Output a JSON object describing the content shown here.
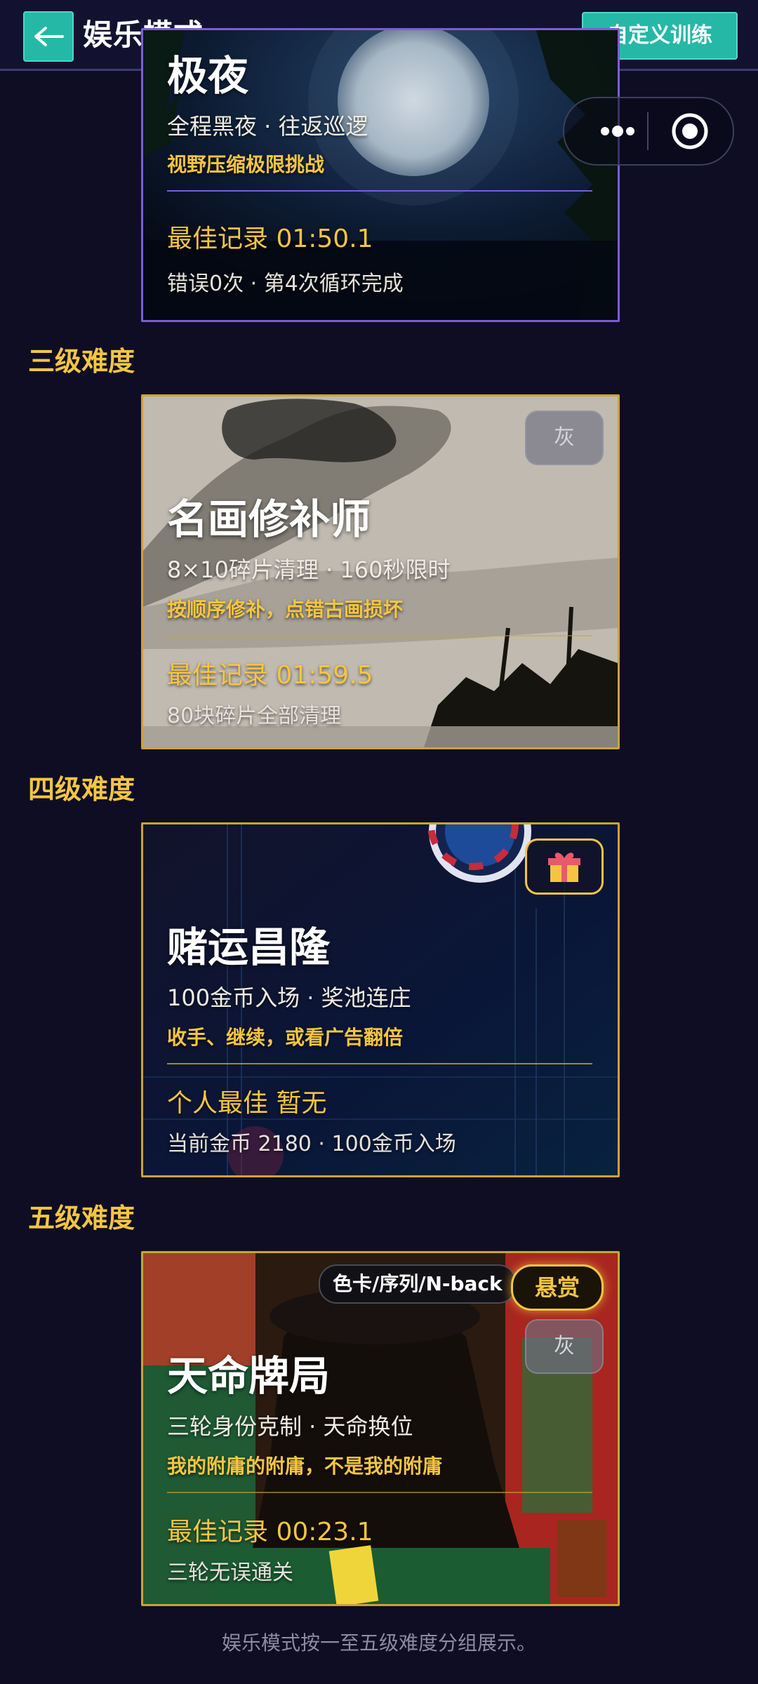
{
  "header": {
    "title": "娱乐模式",
    "custom_button": "自定义训练"
  },
  "levels": [
    {
      "title": "三级难度"
    },
    {
      "title": "四级难度"
    },
    {
      "title": "五级难度"
    }
  ],
  "cards": [
    {
      "title": "极夜",
      "subtitle": "全程黑夜 · 往返巡逻",
      "tip": "视野压缩极限挑战",
      "best": "最佳记录 01:50.1",
      "detail": "错误0次 · 第4次循环完成"
    },
    {
      "title": "名画修补师",
      "subtitle": "8×10碎片清理 · 160秒限时",
      "tip": "按顺序修补，点错古画损坏",
      "best": "最佳记录 01:59.5",
      "detail": "80块碎片全部清理",
      "badge": "灰"
    },
    {
      "title": "赌运昌隆",
      "subtitle": "100金币入场 · 奖池连庄",
      "tip": "收手、继续，或看广告翻倍",
      "best": "个人最佳 暂无",
      "detail": "当前金币 2180 · 100金币入场"
    },
    {
      "title": "天命牌局",
      "subtitle": "三轮身份克制 · 天命换位",
      "tip": "我的附庸的附庸，不是我的附庸",
      "best": "最佳记录 00:23.1",
      "detail": "三轮无误通关",
      "tag": "色卡/序列/N-back",
      "bounty": "悬赏",
      "badge": "灰"
    }
  ],
  "footer": "娱乐模式按一至五级难度分组展示。"
}
